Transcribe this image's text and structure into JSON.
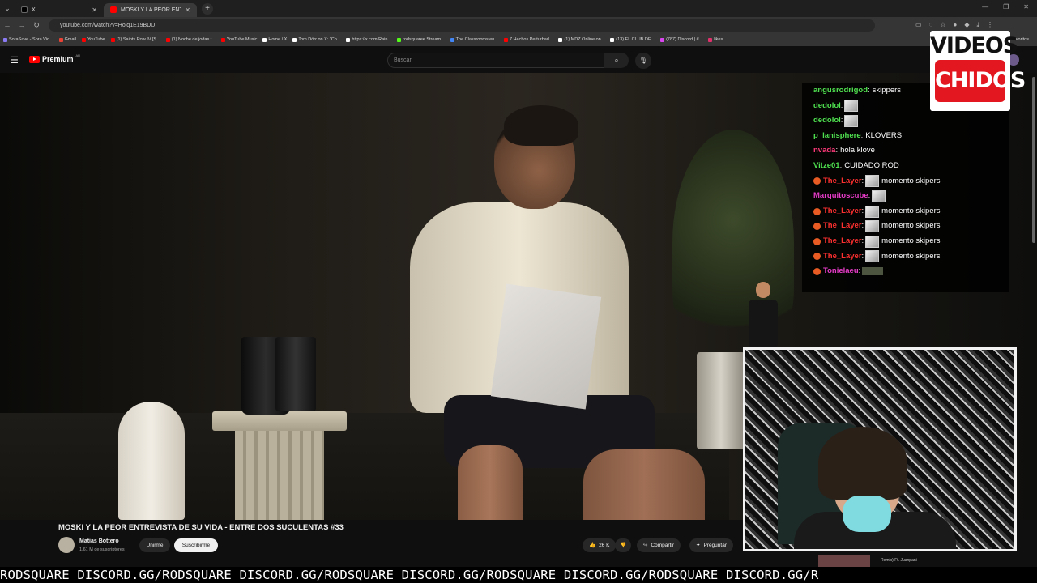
{
  "browser": {
    "tabs": [
      {
        "label": "X",
        "active": false
      },
      {
        "label": "MOSKI Y LA PEOR ENTREVI",
        "active": true
      }
    ],
    "url": "youtube.com/watch?v=Holq1E19BDU",
    "bookmarks": [
      "SoraSave - Sora Vid...",
      "Gmail",
      "YouTube",
      "(1) Saints Row IV [S...",
      "(1) Noche de jodas t...",
      "YouTube Music",
      "Home / X",
      "Tom Dörr on X: \"Co...",
      "https://x.com/Rain...",
      "rodsquaree Stream...",
      "The Classrooms en...",
      "7 Hechos Perturbad...",
      "(1) MDZ Online on...",
      "(13) EL CLUB DE...",
      "(787) Discord | #...",
      "likes"
    ],
    "bookmarks_end": "favoritos"
  },
  "youtube": {
    "brand": "Premium",
    "region": "AR",
    "search_placeholder": "Buscar",
    "video_title": "MOSKI Y LA PEOR ENTREVISTA DE SU VIDA - ENTRE DOS SUCULENTAS #33",
    "channel_name": "Matias Bottero",
    "channel_subs": "1,61 M de suscriptores",
    "join_label": "Unirme",
    "subscribe_label": "Suscribirme",
    "likes": "26 K",
    "share_label": "Compartir",
    "ask_label": "Preguntar",
    "side_video_title": "Remix) Ft. Juanpani"
  },
  "overlay": {
    "logo_line1": "VIDEOS",
    "logo_line2": "CHIDOS",
    "ticker": "RODSQUARE DISCORD.GG/RODSQUARE DISCORD.GG/RODSQUARE DISCORD.GG/RODSQUARE DISCORD.GG/RODSQUARE DISCORD.GG/R",
    "chat": [
      {
        "user": "angusrodrigod",
        "color": "#4fe04f",
        "msg": "skippers",
        "badge": false,
        "emote": ""
      },
      {
        "user": "dedolol",
        "color": "#4fe04f",
        "msg": "",
        "badge": false,
        "emote": "big"
      },
      {
        "user": "dedolol",
        "color": "#4fe04f",
        "msg": "",
        "badge": false,
        "emote": "big"
      },
      {
        "user": "p_lanisphere",
        "color": "#4fe04f",
        "msg": "KLOVERS",
        "badge": false,
        "emote": ""
      },
      {
        "user": "nvada",
        "color": "#ff3a7a",
        "msg": "hola klove",
        "badge": false,
        "emote": ""
      },
      {
        "user": "Vitze01",
        "color": "#4fe04f",
        "msg": "CUIDADO ROD",
        "badge": false,
        "emote": ""
      },
      {
        "user": "The_Layer",
        "color": "#ff3030",
        "msg": "momento skipers",
        "badge": true,
        "emote": "big"
      },
      {
        "user": "Marquitoscube",
        "color": "#e83cc9",
        "msg": "",
        "badge": false,
        "emote": "big"
      },
      {
        "user": "The_Layer",
        "color": "#ff3030",
        "msg": "momento skipers",
        "badge": true,
        "emote": "big"
      },
      {
        "user": "The_Layer",
        "color": "#ff3030",
        "msg": "momento skipers",
        "badge": true,
        "emote": "big"
      },
      {
        "user": "The_Layer",
        "color": "#ff3030",
        "msg": "momento skipers",
        "badge": true,
        "emote": "big"
      },
      {
        "user": "The_Layer",
        "color": "#ff3030",
        "msg": "momento skipers",
        "badge": true,
        "emote": "big"
      },
      {
        "user": "Tonielaeu",
        "color": "#e83cc9",
        "msg": "",
        "badge": true,
        "emote": "small"
      }
    ]
  }
}
